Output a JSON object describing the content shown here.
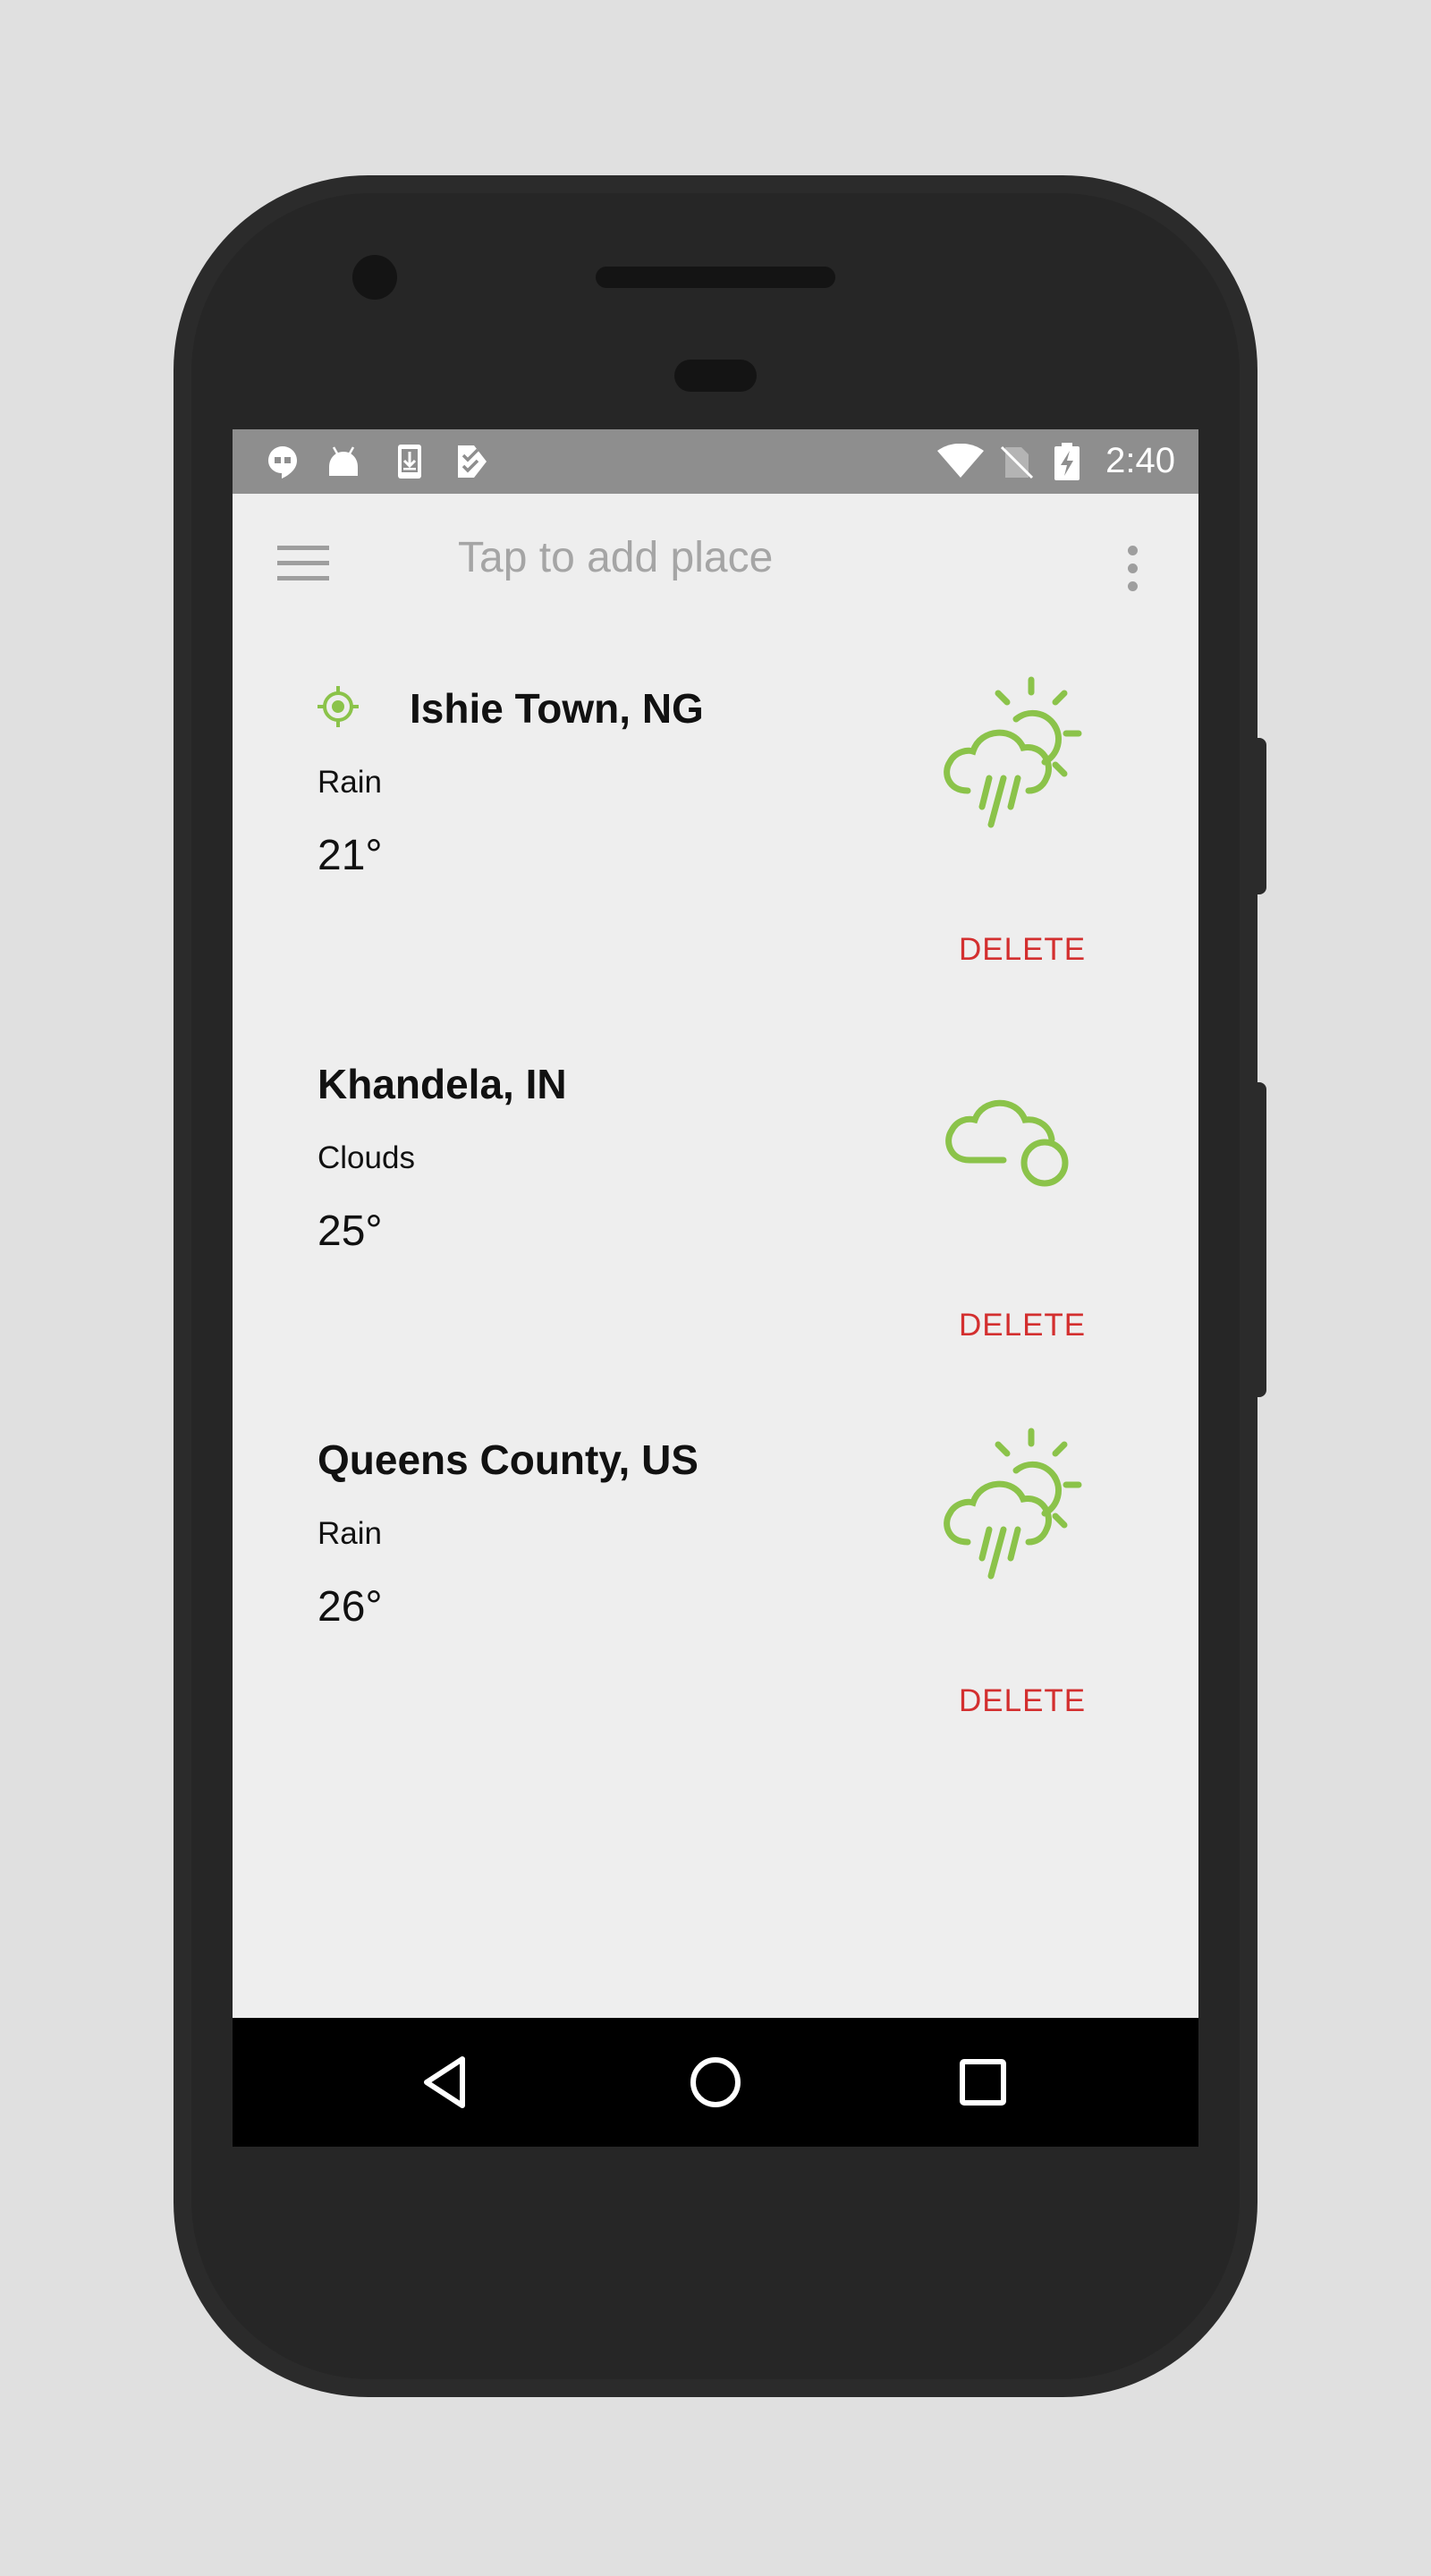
{
  "status_bar": {
    "time": "2:40",
    "left_icons": [
      "hangouts-icon",
      "android-icon",
      "download-icon",
      "task-check-icon"
    ],
    "right_icons": [
      "wifi-icon",
      "no-sim-icon",
      "battery-charging-icon"
    ]
  },
  "app_bar": {
    "search_placeholder": "Tap to add place",
    "menu_icon": "hamburger-menu-icon",
    "overflow_icon": "more-vert-icon"
  },
  "places": [
    {
      "name": "Ishie Town, NG",
      "current_location": true,
      "description": "Rain",
      "temperature": "21°",
      "icon": "rain-sun-cloud-icon",
      "delete_label": "DELETE"
    },
    {
      "name": "Khandela, IN",
      "current_location": false,
      "description": "Clouds",
      "temperature": "25°",
      "icon": "clouds-icon",
      "delete_label": "DELETE"
    },
    {
      "name": "Queens County, US",
      "current_location": false,
      "description": "Rain",
      "temperature": "26°",
      "icon": "rain-sun-cloud-icon",
      "delete_label": "DELETE"
    }
  ],
  "nav_bar": {
    "buttons": [
      "back-icon",
      "home-icon",
      "recents-icon"
    ]
  },
  "colors": {
    "accent_green": "#8bc34a",
    "delete_red": "#d32f2f",
    "status_bar": "#8e8e8e",
    "screen_bg": "#eeeeee"
  }
}
